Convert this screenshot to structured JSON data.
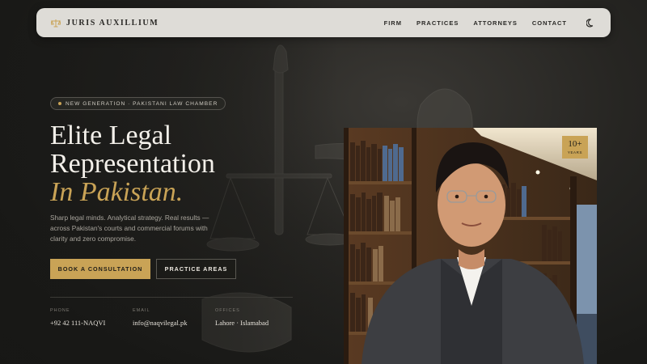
{
  "nav": {
    "brand": "JURIS AUXILLIUM",
    "links": [
      "FIRM",
      "PRACTICES",
      "ATTORNEYS",
      "CONTACT"
    ]
  },
  "hero": {
    "badge": "NEW GENERATION · PAKISTANI LAW CHAMBER",
    "title_line1": "Elite Legal",
    "title_line2": "Representation",
    "title_accent": "In Pakistan.",
    "lead": "Sharp legal minds. Analytical strategy. Real results — across Pakistan's courts and commercial forums with clarity and zero compromise.",
    "cta_primary": "BOOK A CONSULTATION",
    "cta_secondary": "PRACTICE AREAS"
  },
  "contact": {
    "phone_label": "PHONE",
    "phone": "+92 42 111-NAQVI",
    "email_label": "EMAIL",
    "email": "info@naqvilegal.pk",
    "offices_label": "OFFICES",
    "offices": "Lahore · Islamabad"
  },
  "experience": {
    "value": "10+",
    "label": "YEARS"
  },
  "icons": {
    "brand": "scales-icon",
    "theme": "moon-icon"
  },
  "colors": {
    "accent": "#c9a356",
    "background": "#1e1e1c",
    "nav": "#dedcd7"
  }
}
